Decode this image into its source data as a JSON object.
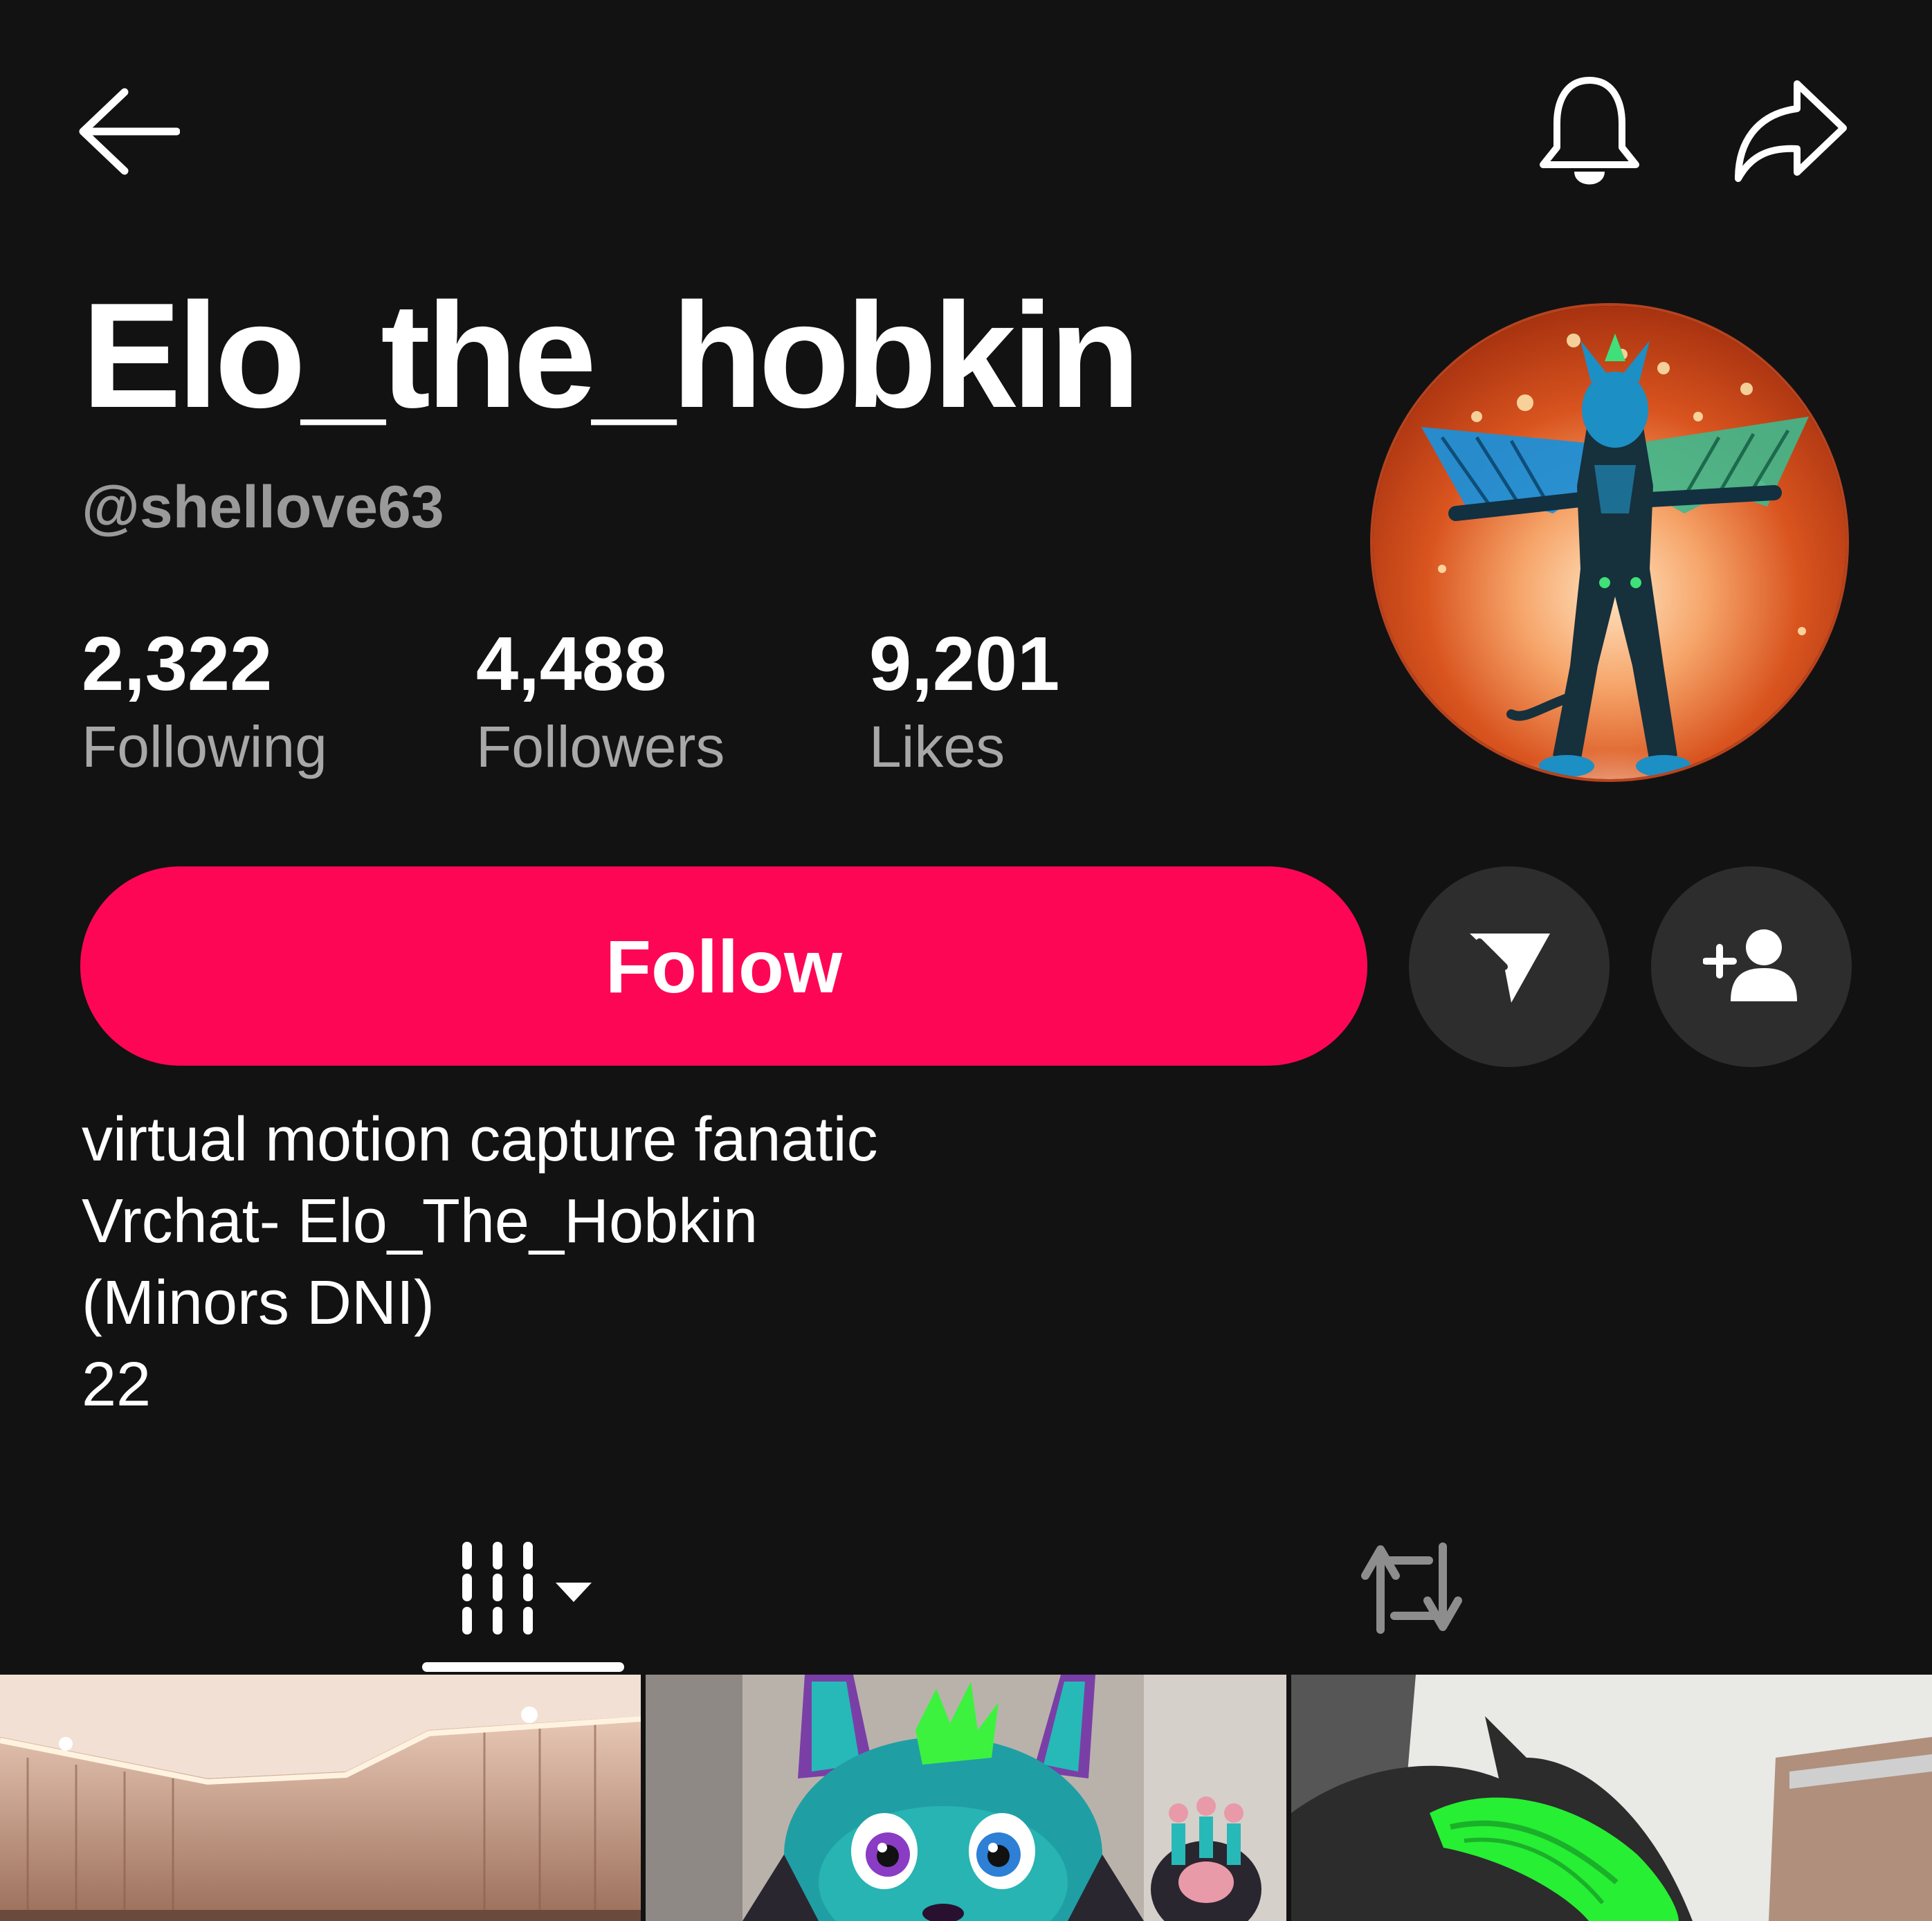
{
  "topbar": {
    "back_icon": "arrow-left-icon",
    "notifications_icon": "bell-icon",
    "share_icon": "share-arrow-icon"
  },
  "profile": {
    "display_name": "Elo_the_hobkin",
    "handle": "@shellove63",
    "stats": [
      {
        "value": "2,322",
        "label": "Following"
      },
      {
        "value": "4,488",
        "label": "Followers"
      },
      {
        "value": "9,201",
        "label": "Likes"
      }
    ],
    "avatar_icon": "avatar"
  },
  "actions": {
    "follow_label": "Follow",
    "follow_color": "#fe0656",
    "message_icon": "send-icon",
    "add_friend_icon": "add-user-icon"
  },
  "bio": {
    "lines": [
      "virtual motion capture fanatic",
      "Vrchat- Elo_The_Hobkin",
      "(Minors DNI)",
      "22"
    ]
  },
  "tabs": {
    "videos_icon": "grid-icon",
    "reposts_icon": "repost-icon"
  }
}
